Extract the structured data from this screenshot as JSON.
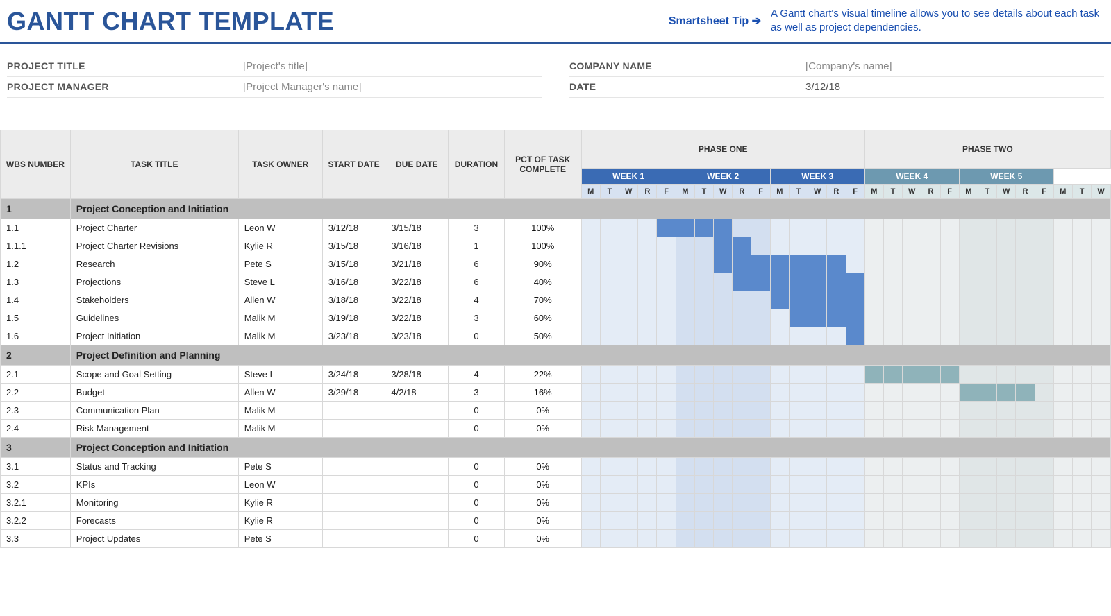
{
  "header": {
    "title": "GANTT CHART TEMPLATE",
    "tip_link": "Smartsheet Tip ➔",
    "tip_text": "A Gantt chart's visual timeline allows you to see details about each task as well as project dependencies."
  },
  "meta": {
    "project_title_label": "PROJECT TITLE",
    "project_title_value": "[Project's title]",
    "project_manager_label": "PROJECT MANAGER",
    "project_manager_value": "[Project Manager's name]",
    "company_name_label": "COMPANY NAME",
    "company_name_value": "[Company's name]",
    "date_label": "DATE",
    "date_value": "3/12/18"
  },
  "columns": {
    "wbs": "WBS NUMBER",
    "title": "TASK TITLE",
    "owner": "TASK OWNER",
    "start": "START DATE",
    "due": "DUE DATE",
    "duration": "DURATION",
    "pct": "PCT OF TASK COMPLETE"
  },
  "phases": {
    "one": "PHASE ONE",
    "two": "PHASE TWO"
  },
  "weeks": [
    "WEEK 1",
    "WEEK 2",
    "WEEK 3",
    "WEEK 4",
    "WEEK 5"
  ],
  "days": [
    "M",
    "T",
    "W",
    "R",
    "F"
  ],
  "sections": [
    {
      "wbs": "1",
      "title": "Project Conception and Initiation"
    },
    {
      "wbs": "2",
      "title": "Project Definition and Planning"
    },
    {
      "wbs": "3",
      "title": "Project Conception and Initiation"
    }
  ],
  "tasks": [
    {
      "wbs": "1.1",
      "title": "Project Charter",
      "owner": "Leon W",
      "start": "3/12/18",
      "due": "3/15/18",
      "duration": "3",
      "pct": "100%",
      "pct_class": "pct-100",
      "bar_start": 5,
      "bar_end": 8,
      "bar_color": "bar-blue"
    },
    {
      "wbs": "1.1.1",
      "title": "Project Charter Revisions",
      "owner": "Kylie R",
      "start": "3/15/18",
      "due": "3/16/18",
      "duration": "1",
      "pct": "100%",
      "pct_class": "pct-100",
      "bar_start": 8,
      "bar_end": 9,
      "bar_color": "bar-blue"
    },
    {
      "wbs": "1.2",
      "title": "Research",
      "owner": "Pete S",
      "start": "3/15/18",
      "due": "3/21/18",
      "duration": "6",
      "pct": "90%",
      "pct_class": "pct-90",
      "bar_start": 8,
      "bar_end": 14,
      "bar_color": "bar-blue"
    },
    {
      "wbs": "1.3",
      "title": "Projections",
      "owner": "Steve L",
      "start": "3/16/18",
      "due": "3/22/18",
      "duration": "6",
      "pct": "40%",
      "pct_class": "pct-40",
      "bar_start": 9,
      "bar_end": 15,
      "bar_color": "bar-blue"
    },
    {
      "wbs": "1.4",
      "title": "Stakeholders",
      "owner": "Allen W",
      "start": "3/18/18",
      "due": "3/22/18",
      "duration": "4",
      "pct": "70%",
      "pct_class": "pct-70",
      "bar_start": 11,
      "bar_end": 15,
      "bar_color": "bar-blue"
    },
    {
      "wbs": "1.5",
      "title": "Guidelines",
      "owner": "Malik M",
      "start": "3/19/18",
      "due": "3/22/18",
      "duration": "3",
      "pct": "60%",
      "pct_class": "pct-60",
      "bar_start": 12,
      "bar_end": 15,
      "bar_color": "bar-blue"
    },
    {
      "wbs": "1.6",
      "title": "Project Initiation",
      "owner": "Malik M",
      "start": "3/23/18",
      "due": "3/23/18",
      "duration": "0",
      "pct": "50%",
      "pct_class": "pct-50",
      "bar_start": 15,
      "bar_end": 15,
      "bar_color": "bar-blue"
    },
    {
      "wbs": "2.1",
      "title": "Scope and Goal Setting",
      "owner": "Steve L",
      "start": "3/24/18",
      "due": "3/28/18",
      "duration": "4",
      "pct": "22%",
      "pct_class": "pct-22",
      "bar_start": 16,
      "bar_end": 20,
      "bar_color": "bar-teal"
    },
    {
      "wbs": "2.2",
      "title": "Budget",
      "owner": "Allen W",
      "start": "3/29/18",
      "due": "4/2/18",
      "duration": "3",
      "pct": "16%",
      "pct_class": "pct-16",
      "bar_start": 21,
      "bar_end": 24,
      "bar_color": "bar-teal"
    },
    {
      "wbs": "2.3",
      "title": "Communication Plan",
      "owner": "Malik M",
      "start": "",
      "due": "",
      "duration": "0",
      "pct": "0%",
      "pct_class": "pct-0",
      "bar_start": -1,
      "bar_end": -1,
      "bar_color": ""
    },
    {
      "wbs": "2.4",
      "title": "Risk Management",
      "owner": "Malik M",
      "start": "",
      "due": "",
      "duration": "0",
      "pct": "0%",
      "pct_class": "pct-0",
      "bar_start": -1,
      "bar_end": -1,
      "bar_color": ""
    },
    {
      "wbs": "3.1",
      "title": "Status and Tracking",
      "owner": "Pete S",
      "start": "",
      "due": "",
      "duration": "0",
      "pct": "0%",
      "pct_class": "pct-0",
      "bar_start": -1,
      "bar_end": -1,
      "bar_color": ""
    },
    {
      "wbs": "3.2",
      "title": "KPIs",
      "owner": "Leon W",
      "start": "",
      "due": "",
      "duration": "0",
      "pct": "0%",
      "pct_class": "pct-0",
      "bar_start": -1,
      "bar_end": -1,
      "bar_color": ""
    },
    {
      "wbs": "3.2.1",
      "title": "Monitoring",
      "owner": "Kylie R",
      "start": "",
      "due": "",
      "duration": "0",
      "pct": "0%",
      "pct_class": "pct-0",
      "bar_start": -1,
      "bar_end": -1,
      "bar_color": ""
    },
    {
      "wbs": "3.2.2",
      "title": "Forecasts",
      "owner": "Kylie R",
      "start": "",
      "due": "",
      "duration": "0",
      "pct": "0%",
      "pct_class": "pct-0",
      "bar_start": -1,
      "bar_end": -1,
      "bar_color": ""
    },
    {
      "wbs": "3.3",
      "title": "Project Updates",
      "owner": "Pete S",
      "start": "",
      "due": "",
      "duration": "0",
      "pct": "0%",
      "pct_class": "pct-0",
      "bar_start": -1,
      "bar_end": -1,
      "bar_color": ""
    }
  ],
  "chart_data": {
    "type": "gantt",
    "title": "GANTT CHART TEMPLATE",
    "start_date": "3/12/18",
    "timeline_unit": "weekday",
    "phases": [
      {
        "name": "PHASE ONE",
        "weeks": [
          "WEEK 1",
          "WEEK 2",
          "WEEK 3"
        ]
      },
      {
        "name": "PHASE TWO",
        "weeks": [
          "WEEK 4",
          "WEEK 5"
        ]
      }
    ],
    "columns_per_week": [
      "M",
      "T",
      "W",
      "R",
      "F"
    ],
    "series": [
      {
        "section": "1",
        "section_title": "Project Conception and Initiation",
        "wbs": "1.1",
        "name": "Project Charter",
        "owner": "Leon W",
        "start": "3/12/18",
        "due": "3/15/18",
        "duration": 3,
        "pct_complete": 100
      },
      {
        "section": "1",
        "section_title": "Project Conception and Initiation",
        "wbs": "1.1.1",
        "name": "Project Charter Revisions",
        "owner": "Kylie R",
        "start": "3/15/18",
        "due": "3/16/18",
        "duration": 1,
        "pct_complete": 100
      },
      {
        "section": "1",
        "section_title": "Project Conception and Initiation",
        "wbs": "1.2",
        "name": "Research",
        "owner": "Pete S",
        "start": "3/15/18",
        "due": "3/21/18",
        "duration": 6,
        "pct_complete": 90
      },
      {
        "section": "1",
        "section_title": "Project Conception and Initiation",
        "wbs": "1.3",
        "name": "Projections",
        "owner": "Steve L",
        "start": "3/16/18",
        "due": "3/22/18",
        "duration": 6,
        "pct_complete": 40
      },
      {
        "section": "1",
        "section_title": "Project Conception and Initiation",
        "wbs": "1.4",
        "name": "Stakeholders",
        "owner": "Allen W",
        "start": "3/18/18",
        "due": "3/22/18",
        "duration": 4,
        "pct_complete": 70
      },
      {
        "section": "1",
        "section_title": "Project Conception and Initiation",
        "wbs": "1.5",
        "name": "Guidelines",
        "owner": "Malik M",
        "start": "3/19/18",
        "due": "3/22/18",
        "duration": 3,
        "pct_complete": 60
      },
      {
        "section": "1",
        "section_title": "Project Conception and Initiation",
        "wbs": "1.6",
        "name": "Project Initiation",
        "owner": "Malik M",
        "start": "3/23/18",
        "due": "3/23/18",
        "duration": 0,
        "pct_complete": 50
      },
      {
        "section": "2",
        "section_title": "Project Definition and Planning",
        "wbs": "2.1",
        "name": "Scope and Goal Setting",
        "owner": "Steve L",
        "start": "3/24/18",
        "due": "3/28/18",
        "duration": 4,
        "pct_complete": 22
      },
      {
        "section": "2",
        "section_title": "Project Definition and Planning",
        "wbs": "2.2",
        "name": "Budget",
        "owner": "Allen W",
        "start": "3/29/18",
        "due": "4/2/18",
        "duration": 3,
        "pct_complete": 16
      },
      {
        "section": "2",
        "section_title": "Project Definition and Planning",
        "wbs": "2.3",
        "name": "Communication Plan",
        "owner": "Malik M",
        "start": "",
        "due": "",
        "duration": 0,
        "pct_complete": 0
      },
      {
        "section": "2",
        "section_title": "Project Definition and Planning",
        "wbs": "2.4",
        "name": "Risk Management",
        "owner": "Malik M",
        "start": "",
        "due": "",
        "duration": 0,
        "pct_complete": 0
      },
      {
        "section": "3",
        "section_title": "Project Conception and Initiation",
        "wbs": "3.1",
        "name": "Status and Tracking",
        "owner": "Pete S",
        "start": "",
        "due": "",
        "duration": 0,
        "pct_complete": 0
      },
      {
        "section": "3",
        "section_title": "Project Conception and Initiation",
        "wbs": "3.2",
        "name": "KPIs",
        "owner": "Leon W",
        "start": "",
        "due": "",
        "duration": 0,
        "pct_complete": 0
      },
      {
        "section": "3",
        "section_title": "Project Conception and Initiation",
        "wbs": "3.2.1",
        "name": "Monitoring",
        "owner": "Kylie R",
        "start": "",
        "due": "",
        "duration": 0,
        "pct_complete": 0
      },
      {
        "section": "3",
        "section_title": "Project Conception and Initiation",
        "wbs": "3.2.2",
        "name": "Forecasts",
        "owner": "Kylie R",
        "start": "",
        "due": "",
        "duration": 0,
        "pct_complete": 0
      },
      {
        "section": "3",
        "section_title": "Project Conception and Initiation",
        "wbs": "3.3",
        "name": "Project Updates",
        "owner": "Pete S",
        "start": "",
        "due": "",
        "duration": 0,
        "pct_complete": 0
      }
    ]
  }
}
